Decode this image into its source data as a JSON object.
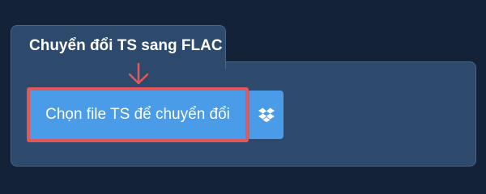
{
  "tab": {
    "title": "Chuyển đổi TS sang FLAC"
  },
  "upload": {
    "choose_label": "Chọn file TS để chuyển đổi",
    "dropbox_icon": "dropbox-icon"
  },
  "colors": {
    "background": "#132237",
    "panel": "#2d4a6c",
    "button": "#4a9be8",
    "highlight": "#e0585a"
  }
}
